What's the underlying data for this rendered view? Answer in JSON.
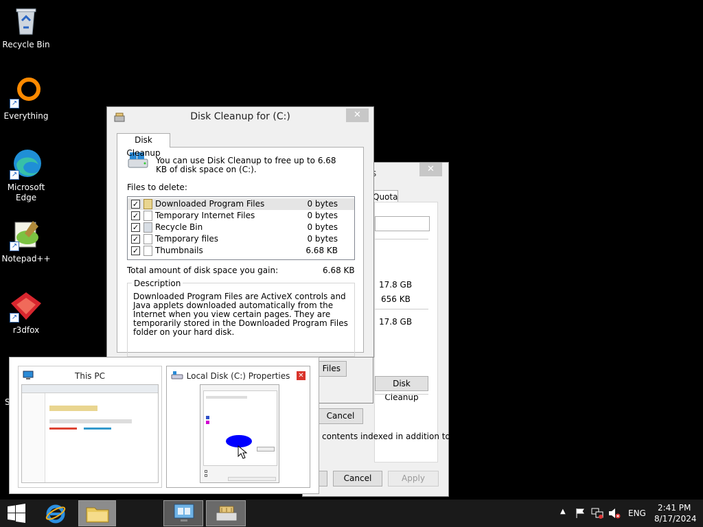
{
  "desktop": {
    "icons": [
      {
        "label": "Recycle Bin"
      },
      {
        "label": "Everything"
      },
      {
        "label": "Microsoft Edge"
      },
      {
        "label": "Notepad++"
      },
      {
        "label": "r3dfox"
      }
    ],
    "partial_label": "S"
  },
  "back_window": {
    "title_fragment": "s",
    "tab_label": "Quota",
    "values": [
      "17.8 GB",
      "656 KB",
      "17.8 GB"
    ],
    "disk_cleanup_button": "Disk Cleanup",
    "index_text": "contents indexed in addition to",
    "cancel_label": "Cancel",
    "apply_label": "Apply"
  },
  "disk_cleanup": {
    "title": "Disk Cleanup for  (C:)",
    "tab": "Disk Cleanup",
    "intro": "You can use Disk Cleanup to free up to 6.68 KB of disk space on  (C:).",
    "files_label": "Files to delete:",
    "files": [
      {
        "name": "Downloaded Program Files",
        "size": "0 bytes"
      },
      {
        "name": "Temporary Internet Files",
        "size": "0 bytes"
      },
      {
        "name": "Recycle Bin",
        "size": "0 bytes"
      },
      {
        "name": "Temporary files",
        "size": "0 bytes"
      },
      {
        "name": "Thumbnails",
        "size": "6.68 KB"
      }
    ],
    "total_label": "Total amount of disk space you gain:",
    "total_value": "6.68 KB",
    "description_label": "Description",
    "description": "Downloaded Program Files are ActiveX controls and Java applets downloaded automatically from the Internet when you view certain pages. They are temporarily stored in the Downloaded Program Files folder on your hard disk.",
    "view_files_fragment": "Files",
    "cancel_label": "Cancel"
  },
  "switcher": {
    "items": [
      {
        "title": "This PC"
      },
      {
        "title": "Local Disk (C:) Properties"
      }
    ]
  },
  "taskbar": {
    "language": "ENG",
    "time": "2:41 PM",
    "date": "8/17/2024"
  },
  "colors": {
    "desktop": "#000000",
    "taskbar": "#1a1a1a",
    "close_red": "#d9342b",
    "pie_blue": "#0000ff"
  }
}
